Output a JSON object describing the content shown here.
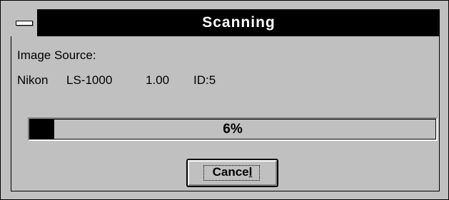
{
  "window": {
    "title": "Scanning",
    "system_menu_icon": "system-menu-icon"
  },
  "source": {
    "label": "Image Source:",
    "device_name": "Nikon",
    "device_model": "LS-1000",
    "device_version": "1.00",
    "device_id": "ID:5"
  },
  "progress": {
    "value_percent": 6,
    "label": "6%"
  },
  "buttons": {
    "cancel_prefix": "Cance",
    "cancel_mnemonic": "l",
    "cancel_label": "Cancel"
  },
  "colors": {
    "dialog_background": "#c0c0c0",
    "titlebar_background": "#000000",
    "title_text": "#ffffff",
    "progress_fill": "#000000"
  }
}
